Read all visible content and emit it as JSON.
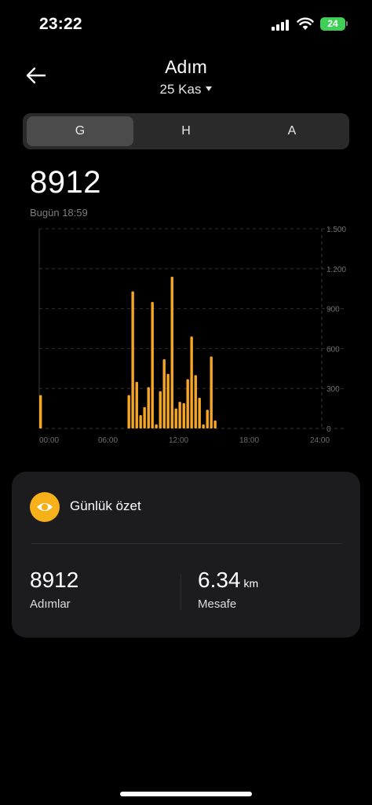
{
  "status_bar": {
    "time": "23:22",
    "battery": "24"
  },
  "header": {
    "title": "Adım",
    "date": "25 Kas"
  },
  "tabs": [
    {
      "label": "G",
      "active": true
    },
    {
      "label": "H",
      "active": false
    },
    {
      "label": "A",
      "active": false
    }
  ],
  "summary": {
    "total": "8912",
    "updated": "Bugün 18:59"
  },
  "chart_data": {
    "type": "bar",
    "x_unit": "hour",
    "x_ticks": [
      "00:00",
      "06:00",
      "12:00",
      "18:00",
      "24:00"
    ],
    "y_ticks": [
      "0",
      "300",
      "600",
      "900",
      "1.200",
      "1.500"
    ],
    "ylim": [
      0,
      1500
    ],
    "xlim": [
      0,
      24
    ],
    "grid": true,
    "color": "#f6a623",
    "bars": [
      {
        "x": 0.0,
        "value": 250
      },
      {
        "x": 7.5,
        "value": 250
      },
      {
        "x": 7.83,
        "value": 1030
      },
      {
        "x": 8.17,
        "value": 350
      },
      {
        "x": 8.5,
        "value": 100
      },
      {
        "x": 8.83,
        "value": 160
      },
      {
        "x": 9.17,
        "value": 310
      },
      {
        "x": 9.5,
        "value": 950
      },
      {
        "x": 9.83,
        "value": 30
      },
      {
        "x": 10.17,
        "value": 280
      },
      {
        "x": 10.5,
        "value": 520
      },
      {
        "x": 10.83,
        "value": 410
      },
      {
        "x": 11.17,
        "value": 1140
      },
      {
        "x": 11.5,
        "value": 150
      },
      {
        "x": 11.83,
        "value": 200
      },
      {
        "x": 12.17,
        "value": 190
      },
      {
        "x": 12.5,
        "value": 370
      },
      {
        "x": 12.83,
        "value": 690
      },
      {
        "x": 13.17,
        "value": 400
      },
      {
        "x": 13.5,
        "value": 230
      },
      {
        "x": 13.83,
        "value": 30
      },
      {
        "x": 14.17,
        "value": 140
      },
      {
        "x": 14.5,
        "value": 540
      },
      {
        "x": 14.83,
        "value": 60
      }
    ]
  },
  "card": {
    "title": "Günlük özet",
    "steps_value": "8912",
    "steps_label": "Adımlar",
    "distance_value": "6.34",
    "distance_unit": "km",
    "distance_label": "Mesafe"
  },
  "colors": {
    "accent": "#f6a623",
    "background": "#000000",
    "card": "#1c1c1e"
  }
}
